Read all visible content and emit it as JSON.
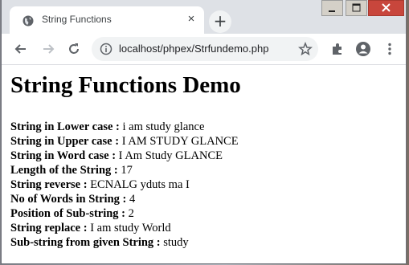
{
  "browser": {
    "tab_title": "String Functions",
    "tab_close": "×",
    "new_tab": "+",
    "url": "localhost/phpex/Strfundemo.php"
  },
  "page": {
    "heading": "String Functions Demo",
    "rows": [
      {
        "label": "String in Lower case : ",
        "value": "i am study glance"
      },
      {
        "label": "String in Upper case : ",
        "value": "I AM STUDY GLANCE"
      },
      {
        "label": "String in Word case : ",
        "value": "I Am Study GLANCE"
      },
      {
        "label": "Length of the String : ",
        "value": "17"
      },
      {
        "label": "String reverse : ",
        "value": "ECNALG yduts ma I"
      },
      {
        "label": "No of Words in String : ",
        "value": "4"
      },
      {
        "label": "Position of Sub-string : ",
        "value": "2"
      },
      {
        "label": "String replace : ",
        "value": "I am study World"
      },
      {
        "label": "Sub-string from given String : ",
        "value": "study"
      }
    ]
  }
}
